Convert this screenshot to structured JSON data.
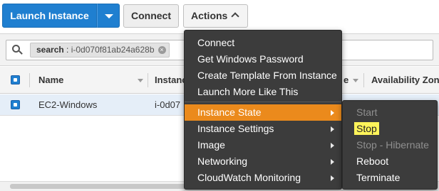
{
  "toolbar": {
    "launch_label": "Launch Instance",
    "connect_label": "Connect",
    "actions_label": "Actions"
  },
  "search": {
    "token_key": "search",
    "token_separator": " : ",
    "token_value": "i-0d070f81ab24a628b",
    "remove_glyph": "×"
  },
  "table": {
    "columns": [
      "Name",
      "Instance ID",
      "Instance Type",
      "Availability Zone"
    ],
    "visible_headers": {
      "name": "Name",
      "instance_partial": "Instanc",
      "type_partial": "e",
      "zone_partial": "Availability Zon"
    },
    "rows": [
      {
        "name": "EC2-Windows",
        "instance_partial": "i-0d07"
      }
    ]
  },
  "actions_menu": {
    "items": [
      {
        "label": "Connect",
        "submenu": false
      },
      {
        "label": "Get Windows Password",
        "submenu": false
      },
      {
        "label": "Create Template From Instance",
        "submenu": false
      },
      {
        "label": "Launch More Like This",
        "submenu": false
      },
      {
        "label": "Instance State",
        "submenu": true,
        "active": true
      },
      {
        "label": "Instance Settings",
        "submenu": true
      },
      {
        "label": "Image",
        "submenu": true
      },
      {
        "label": "Networking",
        "submenu": true
      },
      {
        "label": "CloudWatch Monitoring",
        "submenu": true
      }
    ]
  },
  "instance_state_menu": {
    "items": [
      {
        "label": "Start",
        "enabled": false
      },
      {
        "label": "Stop",
        "enabled": true,
        "highlighted": true
      },
      {
        "label": "Stop - Hibernate",
        "enabled": false
      },
      {
        "label": "Reboot",
        "enabled": true
      },
      {
        "label": "Terminate",
        "enabled": true
      }
    ]
  },
  "colors": {
    "primary_button": "#1f7fd0",
    "menu_background": "#3c3c3c",
    "menu_active": "#eb8a1c",
    "highlight": "#fff45a",
    "selected_row": "#e5eef8"
  },
  "icons": {
    "launch_caret": "caret-down-icon",
    "actions_chevron": "chevron-up-icon",
    "search": "search-icon",
    "token_remove": "close-icon",
    "submenu_arrow": "caret-right-icon"
  }
}
